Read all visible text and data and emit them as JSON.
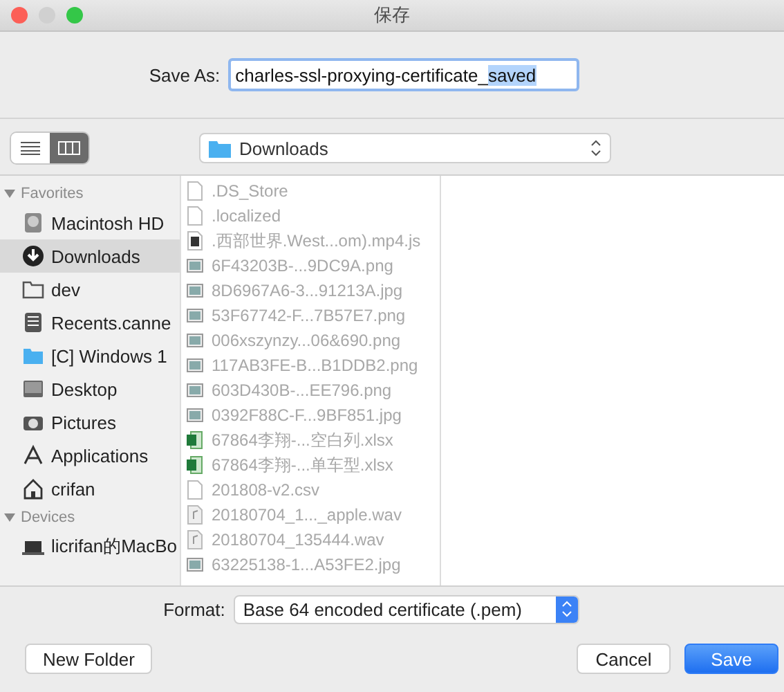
{
  "window": {
    "title": "保存"
  },
  "save_as": {
    "label": "Save As:",
    "value_parts": [
      {
        "text": "charles-ssl-proxying-certificate_",
        "selected": false
      },
      {
        "text": "saved",
        "selected": true
      }
    ]
  },
  "view_toggle": [
    {
      "kind": "list",
      "selected": false
    },
    {
      "kind": "columns",
      "selected": true
    }
  ],
  "location": {
    "label": "Downloads"
  },
  "sidebar": {
    "sections": [
      {
        "title": "Favorites",
        "expanded": true,
        "items": [
          {
            "label": "Macintosh HD",
            "kind": "disk",
            "selected": false
          },
          {
            "label": "Downloads",
            "kind": "download",
            "selected": true
          },
          {
            "label": "dev",
            "kind": "folder",
            "selected": false
          },
          {
            "label": "Recents.canne",
            "kind": "tray",
            "selected": false
          },
          {
            "label": "[C] Windows 1",
            "kind": "bluefolder",
            "selected": false
          },
          {
            "label": "Desktop",
            "kind": "desktop",
            "selected": false
          },
          {
            "label": "Pictures",
            "kind": "camera",
            "selected": false
          },
          {
            "label": "Applications",
            "kind": "apps",
            "selected": false
          },
          {
            "label": "crifan",
            "kind": "home",
            "selected": false
          }
        ]
      },
      {
        "title": "Devices",
        "expanded": true,
        "items": [
          {
            "label": "licrifan的MacBo",
            "kind": "laptop",
            "selected": false
          }
        ]
      }
    ]
  },
  "files": [
    {
      "name": ".DS_Store",
      "kind": "doc"
    },
    {
      "name": ".localized",
      "kind": "doc"
    },
    {
      "name": ".西部世界.West...om).mp4.js",
      "kind": "video"
    },
    {
      "name": "6F43203B-...9DC9A.png",
      "kind": "image"
    },
    {
      "name": "8D6967A6-3...91213A.jpg",
      "kind": "image"
    },
    {
      "name": "53F67742-F...7B57E7.png",
      "kind": "image"
    },
    {
      "name": "006xszynzy...06&690.png",
      "kind": "image"
    },
    {
      "name": "117AB3FE-B...B1DDB2.png",
      "kind": "image"
    },
    {
      "name": "603D430B-...EE796.png",
      "kind": "image"
    },
    {
      "name": "0392F88C-F...9BF851.jpg",
      "kind": "image"
    },
    {
      "name": "67864李翔-...空白列.xlsx",
      "kind": "sheet"
    },
    {
      "name": "67864李翔-...单车型.xlsx",
      "kind": "sheet"
    },
    {
      "name": "201808-v2.csv",
      "kind": "doc"
    },
    {
      "name": "20180704_1..._apple.wav",
      "kind": "audio"
    },
    {
      "name": "20180704_135444.wav",
      "kind": "audio"
    },
    {
      "name": "63225138-1...A53FE2.jpg",
      "kind": "image"
    }
  ],
  "format": {
    "label": "Format:",
    "value": "Base 64 encoded certificate (.pem)"
  },
  "buttons": [
    {
      "label": "New Folder",
      "kind": "plain"
    },
    {
      "label": "Cancel",
      "kind": "plain"
    },
    {
      "label": "Save",
      "kind": "default"
    }
  ]
}
